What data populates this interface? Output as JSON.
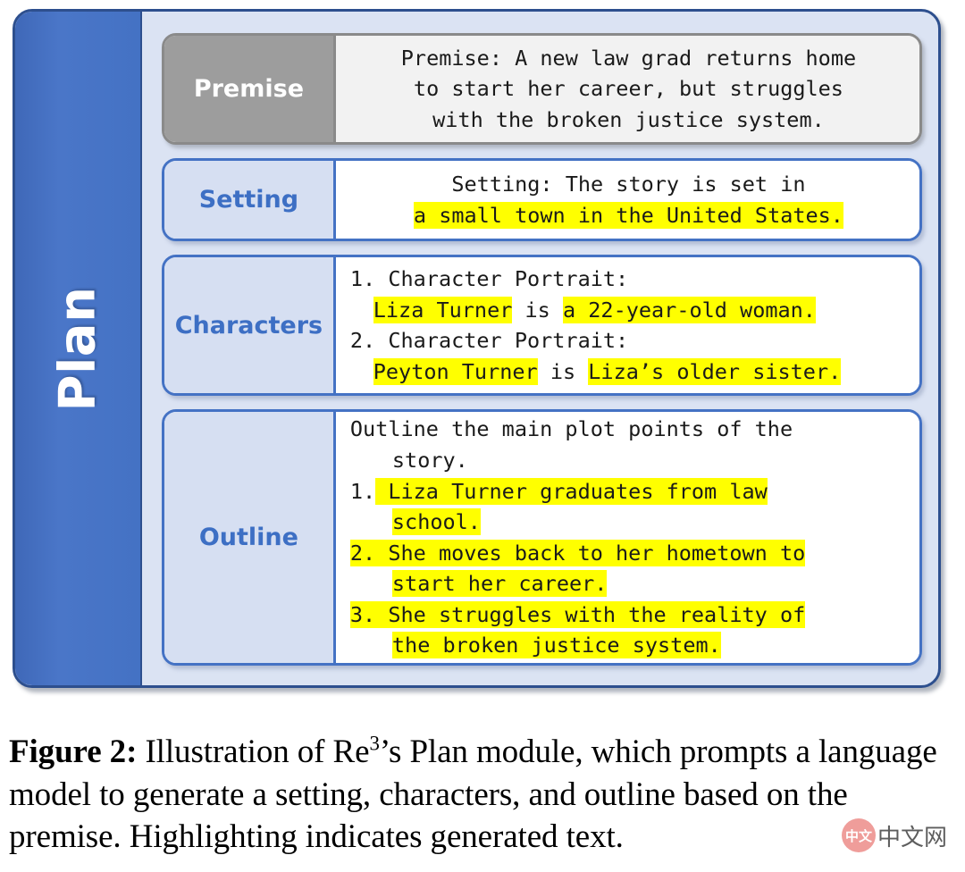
{
  "figure": {
    "sidebar_label": "Plan",
    "rows": [
      {
        "key": "premise",
        "label": "Premise",
        "style": "gray",
        "align": "center",
        "lines": [
          {
            "segments": [
              {
                "text": "Premise: A new law grad returns home",
                "highlight": false
              }
            ]
          },
          {
            "segments": [
              {
                "text": "to start her career, but struggles",
                "highlight": false
              }
            ]
          },
          {
            "segments": [
              {
                "text": "with the broken justice system.",
                "highlight": false
              }
            ]
          }
        ]
      },
      {
        "key": "setting",
        "label": "Setting",
        "style": "blue",
        "align": "center",
        "lines": [
          {
            "segments": [
              {
                "text": "Setting: The story is set in",
                "highlight": false
              }
            ]
          },
          {
            "segments": [
              {
                "text": "a small town in the United States.",
                "highlight": true
              }
            ]
          }
        ]
      },
      {
        "key": "characters",
        "label": "Characters",
        "style": "blue",
        "align": "left",
        "lines": [
          {
            "indent": 0,
            "segments": [
              {
                "text": "1. Character Portrait:",
                "highlight": false
              }
            ]
          },
          {
            "indent": 1,
            "segments": [
              {
                "text": "Liza Turner",
                "highlight": true
              },
              {
                "text": " is ",
                "highlight": false
              },
              {
                "text": "a 22-year-old woman.",
                "highlight": true
              }
            ]
          },
          {
            "indent": 0,
            "segments": [
              {
                "text": "2. Character Portrait:",
                "highlight": false
              }
            ]
          },
          {
            "indent": 1,
            "segments": [
              {
                "text": "Peyton Turner",
                "highlight": true
              },
              {
                "text": " is ",
                "highlight": false
              },
              {
                "text": "Liza’s older sister.",
                "highlight": true
              }
            ]
          }
        ]
      },
      {
        "key": "outline",
        "label": "Outline",
        "style": "blue",
        "align": "left",
        "lines": [
          {
            "indent": 0,
            "segments": [
              {
                "text": "Outline the main plot points of the",
                "highlight": false
              }
            ]
          },
          {
            "indent": 2,
            "segments": [
              {
                "text": "story.",
                "highlight": false
              }
            ]
          },
          {
            "indent": 0,
            "segments": [
              {
                "text": "1.",
                "highlight": false
              },
              {
                "text": " Liza Turner graduates from law",
                "highlight": true
              }
            ]
          },
          {
            "indent": 2,
            "segments": [
              {
                "text": "school.",
                "highlight": true
              }
            ]
          },
          {
            "indent": 0,
            "segments": [
              {
                "text": "2. She moves back to her hometown to",
                "highlight": true
              }
            ]
          },
          {
            "indent": 2,
            "segments": [
              {
                "text": "start her career.",
                "highlight": true
              }
            ]
          },
          {
            "indent": 0,
            "segments": [
              {
                "text": "3. She struggles with the reality of",
                "highlight": true
              }
            ]
          },
          {
            "indent": 2,
            "segments": [
              {
                "text": "the broken justice system.",
                "highlight": true
              }
            ]
          }
        ]
      }
    ]
  },
  "caption": {
    "label": "Figure 2:",
    "text_before_sup": " Illustration of Re",
    "superscript": "3",
    "text_after_sup": "’s Plan module, which prompts a language model to generate a setting, characters, and outline based on the premise. Highlighting indicates generated text."
  },
  "watermark": {
    "badge_text": "中文",
    "text": "中文网"
  },
  "colors": {
    "plan_blue": "#4472C4",
    "plan_border": "#2d4f8e",
    "panel_bg": "#dbe3f3",
    "label_blue_bg": "#d6dff2",
    "label_blue_text": "#3d6fc4",
    "premise_gray": "#9d9d9d",
    "premise_border": "#8a8a8a",
    "premise_bg": "#f2f2f2",
    "highlight": "#FFFF00"
  }
}
